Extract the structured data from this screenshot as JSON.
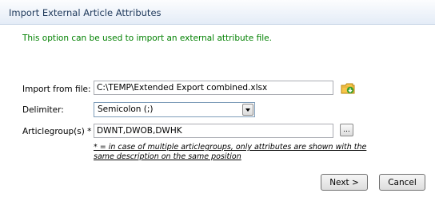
{
  "dialog": {
    "title": "Import External Article Attributes",
    "info": "This option can be used to import an external attribute file."
  },
  "form": {
    "import_label": "Import from file:",
    "import_value": "C:\\TEMP\\Extended Export combined.xlsx",
    "delimiter_label": "Delimiter:",
    "delimiter_value": "Semicolon (;)",
    "articlegroups_label": "Articlegroup(s) * :",
    "articlegroups_value": "DWNT,DWOB,DWHK",
    "ellipsis_label": "...",
    "note": "* = in case of multiple articlegroups, only attributes are shown with the same description on the same position"
  },
  "buttons": {
    "next": "Next >",
    "cancel": "Cancel"
  },
  "icons": {
    "browse": "open-folder-icon",
    "dropdown": "chevron-down-icon"
  },
  "colors": {
    "info_text": "#008000",
    "title_text": "#1e395b",
    "folder": "#f6c54a",
    "folder_arrow": "#3aa02b"
  }
}
